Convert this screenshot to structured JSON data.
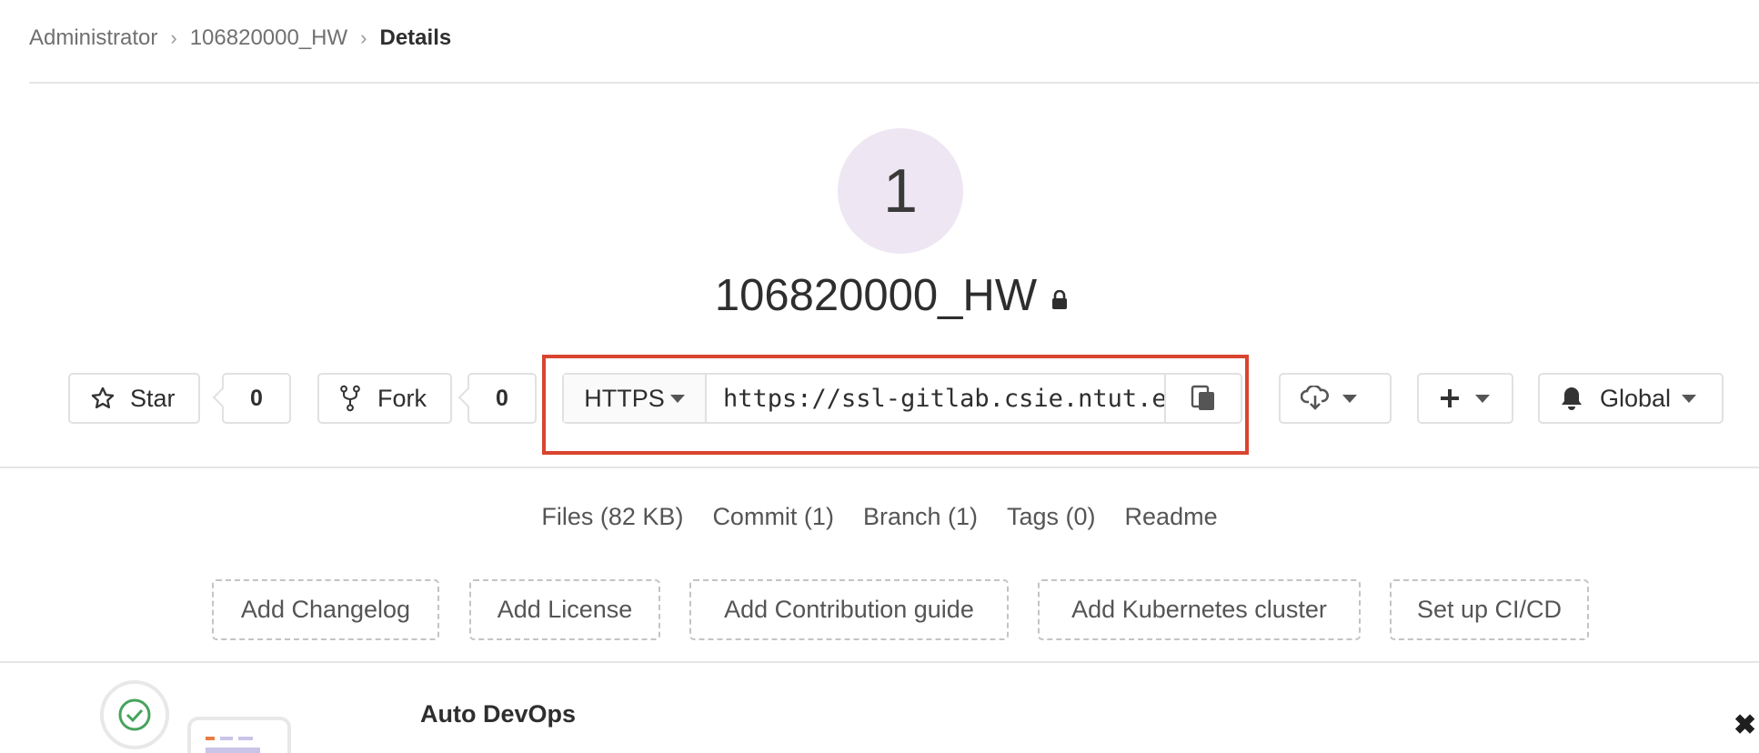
{
  "breadcrumb": {
    "items": [
      "Administrator",
      "106820000_HW"
    ],
    "current": "Details"
  },
  "project": {
    "avatar_letter": "1",
    "name": "106820000_HW"
  },
  "actions": {
    "star_label": "Star",
    "star_count": "0",
    "fork_label": "Fork",
    "fork_count": "0",
    "clone_protocol": "HTTPS",
    "clone_url": "https://ssl-gitlab.csie.ntut.edu.tw/",
    "notification_label": "Global"
  },
  "stats": {
    "files": "Files (82 KB)",
    "commit": "Commit (1)",
    "branch": "Branch (1)",
    "tags": "Tags (0)",
    "readme": "Readme"
  },
  "quick_add": [
    "Add Changelog",
    "Add License",
    "Add Contribution guide",
    "Add Kubernetes cluster",
    "Set up CI/CD"
  ],
  "auto_devops": {
    "title": "Auto DevOps"
  },
  "colors": {
    "highlight": "#d9442f",
    "avatar_bg": "#eee6f3"
  },
  "icons": [
    "star-icon",
    "fork-icon",
    "lock-icon",
    "copy-icon",
    "download-icon",
    "plus-icon",
    "bell-icon",
    "close-icon"
  ]
}
